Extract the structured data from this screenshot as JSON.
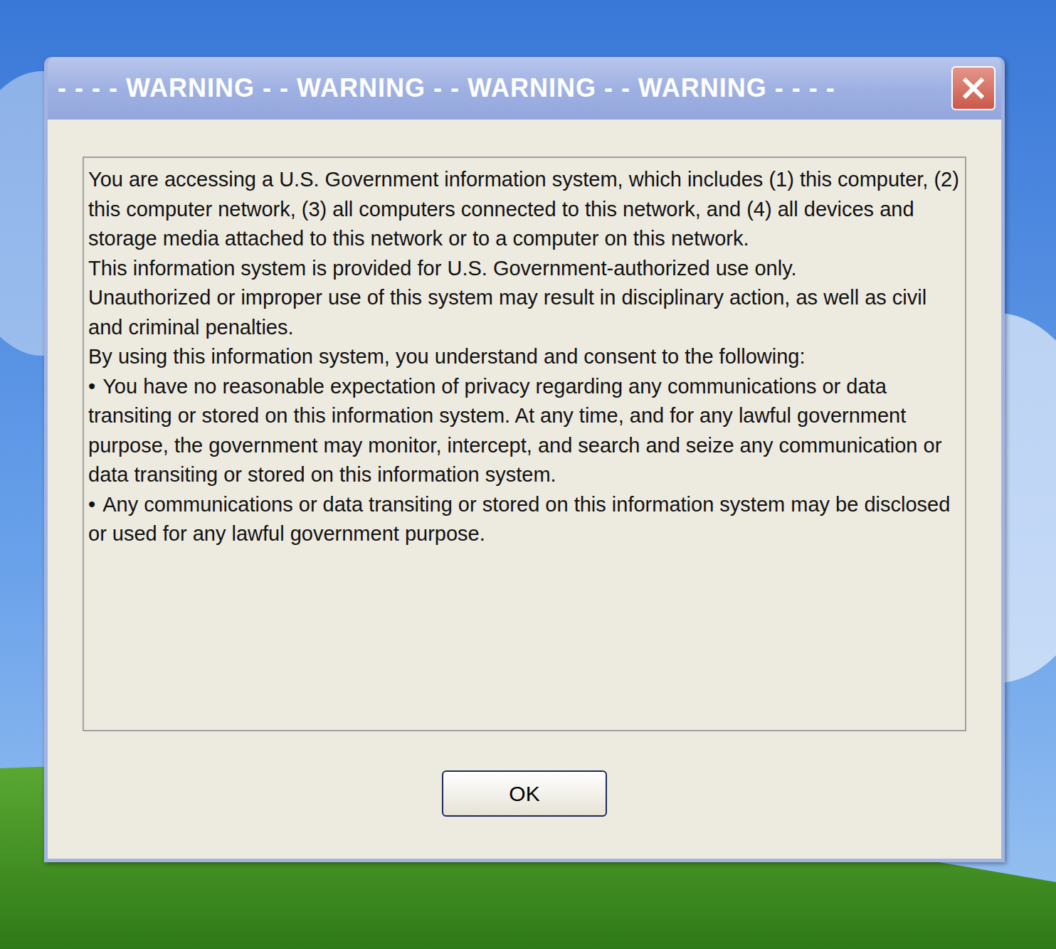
{
  "window": {
    "title": "- - - - WARNING - - WARNING - - WARNING - - WARNING - - - -"
  },
  "message": [
    {
      "kind": "paragraph",
      "bullet": "",
      "text": "You are accessing a U.S. Government information system, which includes (1) this computer, (2) this computer network, (3) all computers connected to this network, and (4) all devices and storage media attached to this network or to a computer on this network."
    },
    {
      "kind": "paragraph",
      "bullet": "",
      "text": "This information system is provided for U.S. Government-authorized use only."
    },
    {
      "kind": "paragraph",
      "bullet": "",
      "text": "Unauthorized or improper use of this system may result in disciplinary action, as well as civil and criminal penalties."
    },
    {
      "kind": "paragraph",
      "bullet": "",
      "text": "By using this information system, you understand and consent to the following:"
    },
    {
      "kind": "bullet",
      "bullet": "•",
      "text": "You have no reasonable expectation of privacy regarding any communications or data transiting or stored on this information system. At any time, and for any lawful government purpose, the government may monitor, intercept, and search and seize any communication or data transiting or stored on this information system."
    },
    {
      "kind": "bullet",
      "bullet": "•",
      "text": "Any communications or data transiting or stored on this information system may be disclosed or used for any lawful government purpose."
    }
  ],
  "buttons": [
    "OK"
  ]
}
